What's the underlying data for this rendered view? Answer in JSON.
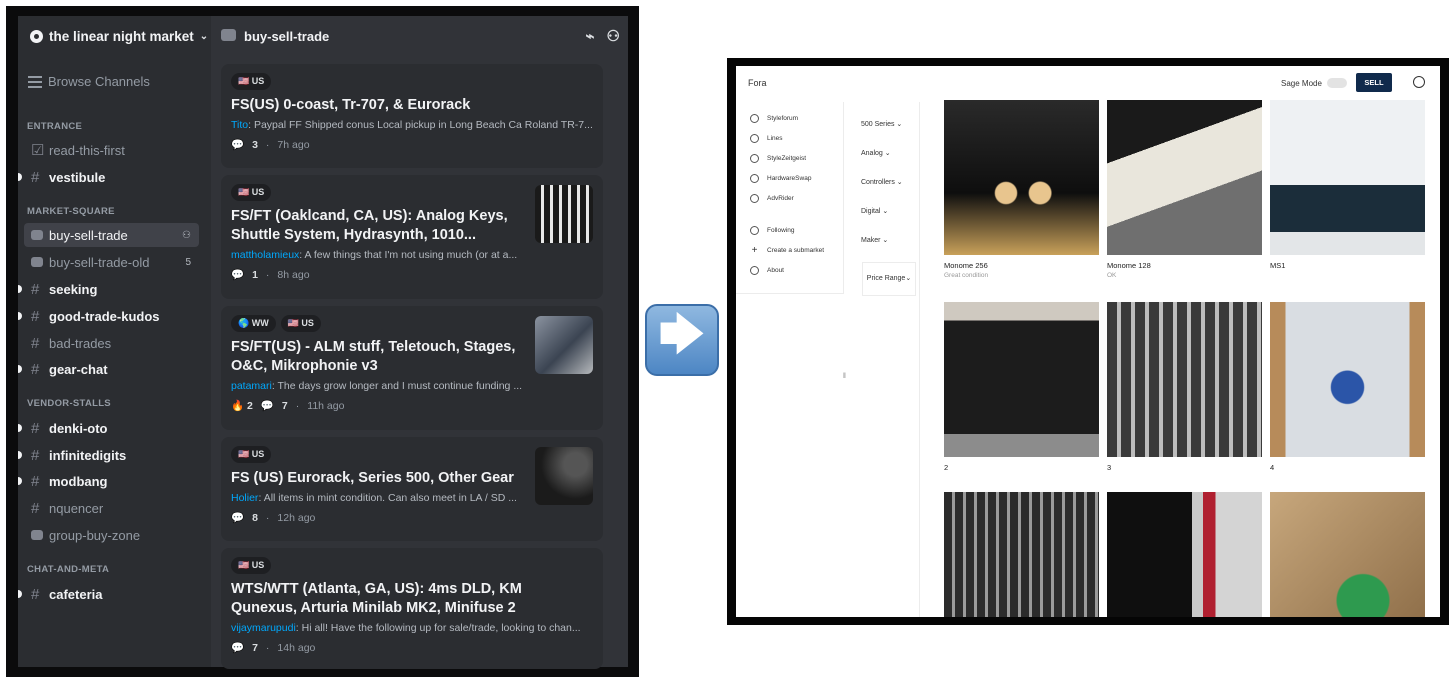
{
  "left": {
    "server_name": "the linear night market",
    "browse_channels": "Browse Channels",
    "categories": [
      {
        "label": "ENTRANCE",
        "channels": [
          {
            "name": "read-this-first",
            "bright": false
          },
          {
            "name": "vestibule",
            "bright": true
          }
        ]
      },
      {
        "label": "MARKET-SQUARE",
        "channels": [
          {
            "name": "buy-sell-trade",
            "active": true
          },
          {
            "name": "buy-sell-trade-old",
            "count": "5"
          },
          {
            "name": "seeking",
            "bright": true
          },
          {
            "name": "good-trade-kudos",
            "bright": true
          },
          {
            "name": "bad-trades",
            "bright": false
          },
          {
            "name": "gear-chat",
            "bright": true
          }
        ]
      },
      {
        "label": "VENDOR-STALLS",
        "channels": [
          {
            "name": "denki-oto",
            "bright": true
          },
          {
            "name": "infinitedigits",
            "bright": true
          },
          {
            "name": "modbang",
            "bright": true
          },
          {
            "name": "nquencer",
            "bright": false
          },
          {
            "name": "group-buy-zone",
            "bright": false
          }
        ]
      },
      {
        "label": "CHAT-AND-META",
        "channels": [
          {
            "name": "cafeteria",
            "bright": true
          }
        ]
      }
    ],
    "channel_header": "buy-sell-trade",
    "posts": [
      {
        "tags": [
          "🇺🇸 US"
        ],
        "title": "FS(US) 0-coast, Tr-707, & Eurorack",
        "author": "Tito",
        "preview": ": Paypal FF Shipped conus Local pickup in Long Beach Ca Roland TR-7...",
        "replies": "3",
        "time": "7h ago"
      },
      {
        "tags": [
          "🇺🇸 US"
        ],
        "title": "FS/FT (Oaklcand, CA, US): Analog Keys, Shuttle System, Hydrasynth, 1010...",
        "author": "mattholamieux",
        "preview": ": A few things that I'm not using much (or at a...",
        "replies": "1",
        "time": "8h ago"
      },
      {
        "tags": [
          "🌎 WW",
          "🇺🇸 US"
        ],
        "title": "FS/FT(US) - ALM stuff, Teletouch, Stages, O&C, Mikrophonie v3",
        "author": "patamari",
        "preview": ": The days grow longer and I must continue funding ...",
        "reaction": "🔥 2",
        "replies": "7",
        "time": "11h ago"
      },
      {
        "tags": [
          "🇺🇸 US"
        ],
        "title": "FS (US) Eurorack, Series 500, Other Gear",
        "author": "Holier",
        "preview": ": All items in mint condition. Can also meet in LA / SD ...",
        "replies": "8",
        "time": "12h ago"
      },
      {
        "tags": [
          "🇺🇸 US"
        ],
        "title": "WTS/WTT (Atlanta, GA, US): 4ms DLD, KM Qunexus, Arturia Minilab MK2, Minifuse 2",
        "author": "vijaymarupudi",
        "preview": ": Hi all! Have the following up for sale/trade, looking to chan...",
        "replies": "7",
        "time": "14h ago"
      }
    ]
  },
  "arrow": "🡆",
  "right": {
    "brand": "Fora",
    "sage_mode": "Sage Mode",
    "sell": "SELL",
    "menu": [
      "Styleforum",
      "Lines",
      "StyleZeitgeist",
      "HardwareSwap",
      "AdvRider"
    ],
    "menu2": [
      "Following",
      "Create a submarket",
      "About"
    ],
    "filters": [
      "500 Series",
      "Analog",
      "Controllers",
      "Digital",
      "Maker"
    ],
    "price_range": "Price Range",
    "listings": [
      {
        "title": "Monome 256",
        "subtitle": "Great condition"
      },
      {
        "title": "Monome 128",
        "subtitle": "OK"
      },
      {
        "title": "MS1",
        "subtitle": ""
      },
      {
        "title": "2",
        "subtitle": ""
      },
      {
        "title": "3",
        "subtitle": ""
      },
      {
        "title": "4",
        "subtitle": ""
      },
      {
        "title": "",
        "subtitle": ""
      },
      {
        "title": "",
        "subtitle": ""
      },
      {
        "title": "",
        "subtitle": ""
      }
    ]
  }
}
